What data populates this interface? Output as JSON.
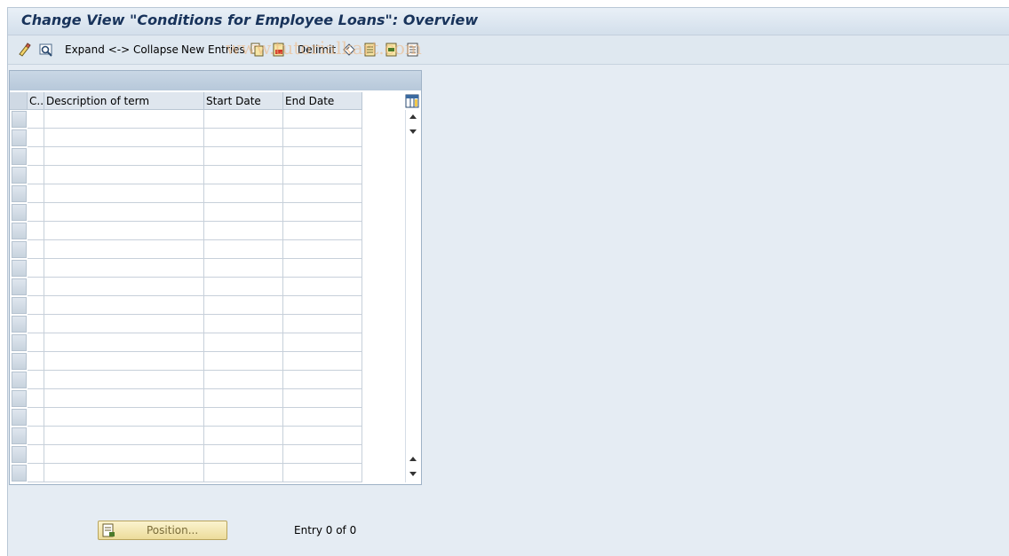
{
  "window": {
    "title": "Change View \"Conditions for Employee Loans\": Overview"
  },
  "toolbar": {
    "expand_collapse_label": "Expand <-> Collapse",
    "new_entries_label": "New Entries",
    "delimit_label": "Delimit",
    "watermark": "www.tutorialkart.com"
  },
  "table": {
    "columns": [
      "C..",
      "Description of term",
      "Start Date",
      "End Date"
    ],
    "row_count": 20
  },
  "footer": {
    "position_label": "Position...",
    "entry_text": "Entry 0 of 0"
  }
}
